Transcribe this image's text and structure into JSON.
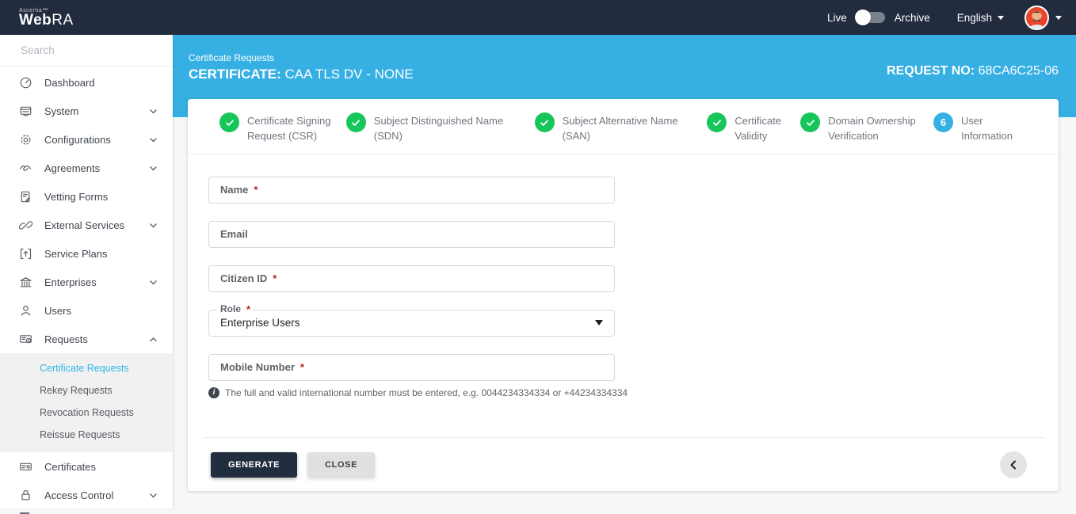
{
  "colors": {
    "topbar_bg": "#222c3e",
    "accent_blue": "#36b0e2",
    "success_green": "#16c65a",
    "active_link": "#2eb6ea",
    "required_red": "#b3261e",
    "generate_button_bg": "#222d3f",
    "avatar_bg": "#e8452c"
  },
  "topbar": {
    "brand_small": "Ascertia™",
    "brand_bold": "Web",
    "brand_light": "RA",
    "live_label": "Live",
    "archive_label": "Archive",
    "language_label": "English"
  },
  "sidebar": {
    "search_placeholder": "Search",
    "items": [
      {
        "label": "Dashboard",
        "icon": "dashboard-icon",
        "expandable": false
      },
      {
        "label": "System",
        "icon": "system-icon",
        "expandable": true
      },
      {
        "label": "Configurations",
        "icon": "gear-icon",
        "expandable": true
      },
      {
        "label": "Agreements",
        "icon": "handshake-icon",
        "expandable": true
      },
      {
        "label": "Vetting Forms",
        "icon": "form-icon",
        "expandable": false
      },
      {
        "label": "External Services",
        "icon": "link-icon",
        "expandable": true
      },
      {
        "label": "Service Plans",
        "icon": "service-plan-icon",
        "expandable": false
      },
      {
        "label": "Enterprises",
        "icon": "bank-icon",
        "expandable": true
      },
      {
        "label": "Users",
        "icon": "user-icon",
        "expandable": false
      },
      {
        "label": "Requests",
        "icon": "requests-icon",
        "expandable": true,
        "expanded": true
      }
    ],
    "submenu": [
      {
        "label": "Certificate Requests",
        "active": true
      },
      {
        "label": "Rekey Requests",
        "active": false
      },
      {
        "label": "Revocation Requests",
        "active": false
      },
      {
        "label": "Reissue Requests",
        "active": false
      }
    ],
    "items_after": [
      {
        "label": "Certificates",
        "icon": "certificate-icon",
        "expandable": false
      },
      {
        "label": "Access Control",
        "icon": "lock-icon",
        "expandable": true
      }
    ]
  },
  "header": {
    "breadcrumb": "Certificate Requests",
    "title_label": "CERTIFICATE:",
    "title_value": "CAA TLS DV - NONE",
    "request_label": "REQUEST NO:",
    "request_value": "68CA6C25-06"
  },
  "stepper": {
    "steps": [
      {
        "label": "Certificate Signing Request (CSR)",
        "state": "done"
      },
      {
        "label": "Subject Distinguished Name (SDN)",
        "state": "done"
      },
      {
        "label": "Subject Alternative Name (SAN)",
        "state": "done"
      },
      {
        "label": "Certificate Validity",
        "state": "done"
      },
      {
        "label": "Domain Ownership Verification",
        "state": "done"
      },
      {
        "label": "User Information",
        "state": "current",
        "number": "6"
      }
    ]
  },
  "form": {
    "required_marker": "*",
    "name_label": "Name",
    "name_value": "",
    "email_label": "Email",
    "email_value": "",
    "citizen_label": "Citizen ID",
    "citizen_value": "",
    "role_label": "Role",
    "role_value": "Enterprise Users",
    "mobile_label": "Mobile Number",
    "mobile_value": "",
    "mobile_helper": "The full and valid international number must be entered, e.g. 0044234334334 or +44234334334",
    "info_glyph": "i"
  },
  "footer": {
    "generate_label": "GENERATE",
    "close_label": "CLOSE"
  }
}
